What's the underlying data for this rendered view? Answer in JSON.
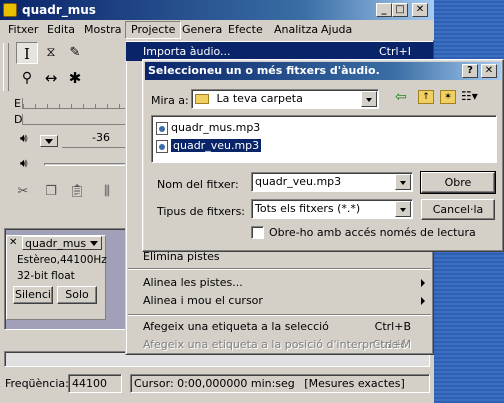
{
  "window": {
    "title": "quadr_mus",
    "min_glyph": "_",
    "max_glyph": "□",
    "close_glyph": "✕"
  },
  "menubar": [
    "Fitxer",
    "Edita",
    "Mostra",
    "Projecte",
    "Genera",
    "Efecte",
    "Analitza",
    "Ajuda"
  ],
  "ruler": {
    "tick_label": "-36"
  },
  "meters": {
    "label_e": "E",
    "label_d": "D"
  },
  "track": {
    "name": "quadr_mus",
    "info_line1": "Estèreo,44100Hz",
    "info_line2": "32-bit float",
    "mute_label": "Silenci",
    "solo_label": "Solo"
  },
  "statusbar": {
    "freq_label": "Freqüència:",
    "freq_value": "44100",
    "cursor_text": "Cursor: 0:00,000000 min:seg",
    "snap_text": "[Mesures exactes]"
  },
  "project_menu": {
    "top_item": {
      "label": "Importa àudio...",
      "accel": "Ctrl+I"
    },
    "partial_item": "Elimina pistes",
    "items": [
      {
        "label": "Alinea les pistes...",
        "submenu": true
      },
      {
        "label": "Alinea i mou el cursor",
        "submenu": true
      },
      {
        "label": "Afegeix una etiqueta a la selecció",
        "accel": "Ctrl+B"
      },
      {
        "label": "Afegeix una etiqueta a la posició d'interpretació",
        "accel": "Ctrl+M",
        "disabled": true
      }
    ]
  },
  "dialog": {
    "title": "Seleccioneu un o més fitxers d'àudio.",
    "help_glyph": "?",
    "close_glyph": "✕",
    "look_in_label": "Mira a:",
    "look_in_value": "La teva carpeta",
    "files": [
      "quadr_mus.mp3",
      "quadr_veu.mp3"
    ],
    "selected_file_index": 1,
    "filename_label": "Nom del fitxer:",
    "filename_value": "quadr_veu.mp3",
    "filetype_label": "Tipus de fitxers:",
    "filetype_value": "Tots els fitxers (*.*)",
    "readonly_label": "Obre-ho amb accés només de lectura",
    "readonly_checked": false,
    "open_label": "Obre",
    "cancel_label": "Cancel·la"
  },
  "colors": {
    "titlebar": "#0a246a",
    "selection": "#0a246a",
    "desktop": "#3a6ea5"
  }
}
